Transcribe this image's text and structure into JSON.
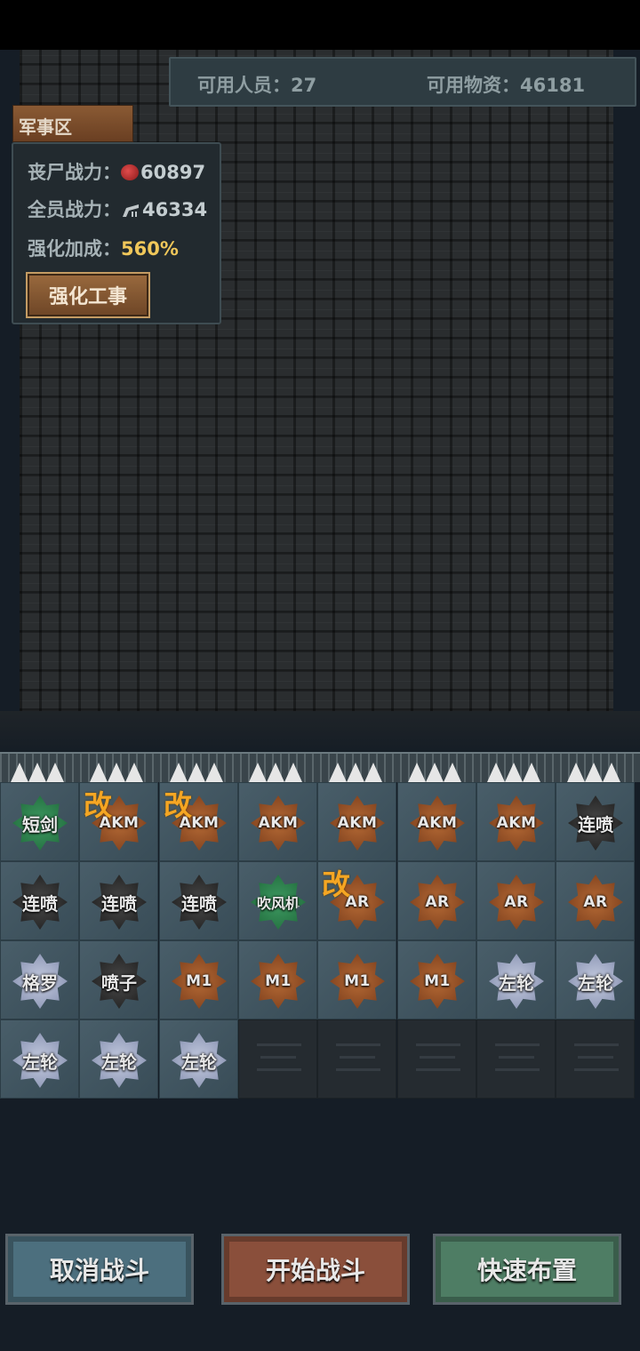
{
  "resources": {
    "personnel_label": "可用人员：",
    "personnel_value": "27",
    "supplies_label": "可用物资：",
    "supplies_value": "46181"
  },
  "zone": {
    "name": "军事区",
    "zombie_power_label": "丧尸战力：",
    "zombie_power_value": "60897",
    "team_power_label": "全员战力：",
    "team_power_value": "46334",
    "bonus_label": "强化加成：",
    "bonus_value": "560%",
    "upgrade_button": "强化工事"
  },
  "mod_label": "改",
  "units": [
    {
      "label": "短剑",
      "style": "green",
      "mod": false
    },
    {
      "label": "AKM",
      "style": "orange",
      "mod": true
    },
    {
      "label": "AKM",
      "style": "orange",
      "mod": true
    },
    {
      "label": "AKM",
      "style": "orange",
      "mod": false
    },
    {
      "label": "AKM",
      "style": "orange",
      "mod": false
    },
    {
      "label": "AKM",
      "style": "orange",
      "mod": false
    },
    {
      "label": "AKM",
      "style": "orange",
      "mod": false
    },
    {
      "label": "连喷",
      "style": "black",
      "mod": false
    },
    {
      "label": "连喷",
      "style": "black",
      "mod": false
    },
    {
      "label": "连喷",
      "style": "black",
      "mod": false
    },
    {
      "label": "连喷",
      "style": "black",
      "mod": false
    },
    {
      "label": "吹风机",
      "style": "green",
      "mod": false
    },
    {
      "label": "AR",
      "style": "orange",
      "mod": true
    },
    {
      "label": "AR",
      "style": "orange",
      "mod": false
    },
    {
      "label": "AR",
      "style": "orange",
      "mod": false
    },
    {
      "label": "AR",
      "style": "orange",
      "mod": false
    },
    {
      "label": "格罗",
      "style": "silver",
      "mod": false
    },
    {
      "label": "喷子",
      "style": "black",
      "mod": false
    },
    {
      "label": "M1",
      "style": "orange",
      "mod": false
    },
    {
      "label": "M1",
      "style": "orange",
      "mod": false
    },
    {
      "label": "M1",
      "style": "orange",
      "mod": false
    },
    {
      "label": "M1",
      "style": "orange",
      "mod": false
    },
    {
      "label": "左轮",
      "style": "silver",
      "mod": false
    },
    {
      "label": "左轮",
      "style": "silver",
      "mod": false
    },
    {
      "label": "左轮",
      "style": "silver",
      "mod": false
    },
    {
      "label": "左轮",
      "style": "silver",
      "mod": false
    },
    {
      "label": "左轮",
      "style": "silver",
      "mod": false
    }
  ],
  "empty_slots": 5,
  "buttons": {
    "cancel": "取消战斗",
    "start": "开始战斗",
    "quick_deploy": "快速布置"
  },
  "colors": {
    "orange_badge": "#8e4c24",
    "green_badge": "#2a7a48",
    "black_badge": "#2c2c2c",
    "silver_badge": "#9aa3bf",
    "mod_label": "#f5a623",
    "bonus_value": "#f0c75a"
  }
}
